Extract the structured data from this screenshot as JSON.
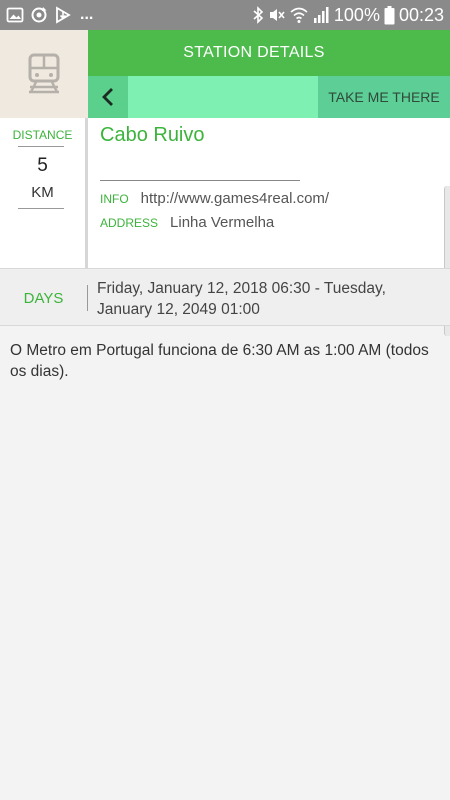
{
  "status_bar": {
    "more": "...",
    "battery": "100%",
    "time": "00:23",
    "icons": [
      "image-icon",
      "sync-icon",
      "download-icon",
      "bluetooth-icon",
      "mute-icon",
      "wifi-icon",
      "signal-icon",
      "battery-icon"
    ]
  },
  "header": {
    "title": "STATION DETAILS"
  },
  "nav": {
    "take_me_there": "TAKE ME THERE"
  },
  "distance": {
    "label": "DISTANCE",
    "value": "5",
    "unit": "KM"
  },
  "station": {
    "name": "Cabo Ruivo",
    "info_label": "INFO",
    "info_value": "http://www.games4real.com/",
    "address_label": "ADDRESS",
    "address_value": "Linha Vermelha"
  },
  "days": {
    "label": "DAYS",
    "value": "Friday, January 12, 2018 06:30 - Tuesday, January 12, 2049 01:00"
  },
  "description": "O Metro em Portugal funciona de 6:30 AM as 1:00 AM (todos os dias).",
  "colors": {
    "accent": "#4cbb4c",
    "nav_bar": "#7ef0b2",
    "label_green": "#3cb43c"
  }
}
